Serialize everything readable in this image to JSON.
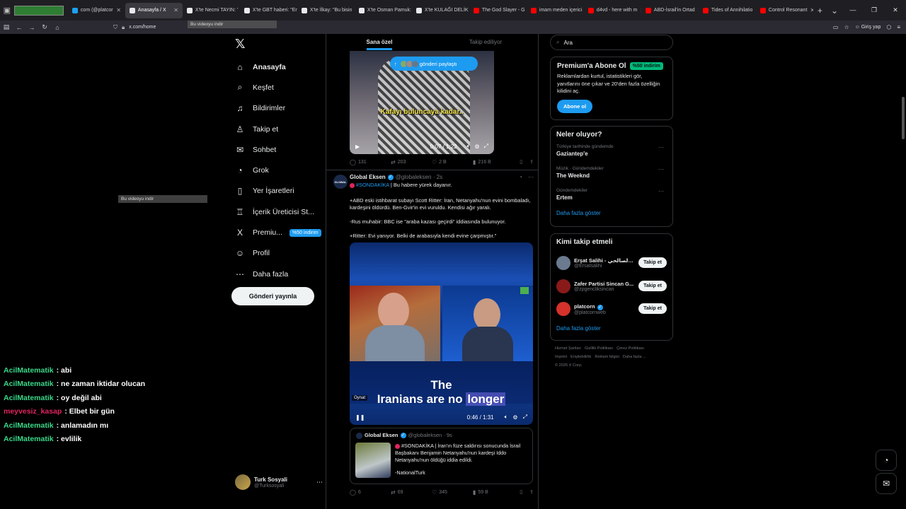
{
  "browser": {
    "tabs": [
      {
        "label": "com (@platcor",
        "color": "#1da1f2",
        "active": false
      },
      {
        "label": "Anasayfa / X",
        "color": "#e7e9ea",
        "active": true
      },
      {
        "label": "X'te Necmi TAYIN: '",
        "color": "#e7e9ea",
        "active": false
      },
      {
        "label": "X'te GBT haberi: \"En",
        "color": "#e7e9ea",
        "active": false
      },
      {
        "label": "X'te İlkay: \"Bu bisin",
        "color": "#e7e9ea",
        "active": false
      },
      {
        "label": "X'te Osman Pamuk:",
        "color": "#e7e9ea",
        "active": false
      },
      {
        "label": "X'te KULAĞI DELİK",
        "color": "#e7e9ea",
        "active": false
      },
      {
        "label": "The God Slayer - G",
        "color": "#ff0000",
        "active": false
      },
      {
        "label": "imam meden içerici",
        "color": "#ff0000",
        "active": false
      },
      {
        "label": "d4vd - here with m",
        "color": "#ff0000",
        "active": false
      },
      {
        "label": "ABD-İsrail'in Ortad",
        "color": "#ff0000",
        "active": false
      },
      {
        "label": "Tides of Annihilatio",
        "color": "#ff0000",
        "active": false
      },
      {
        "label": "Control Resonant",
        "color": "#ff0000",
        "active": false
      }
    ],
    "url": "x.com/home",
    "signin_label": "Giriş yap"
  },
  "sidebar": {
    "items": [
      {
        "label": "Anasayfa",
        "icon": "home-icon",
        "glyph": "⌂"
      },
      {
        "label": "Keşfet",
        "icon": "search-icon",
        "glyph": "⌕"
      },
      {
        "label": "Bildirimler",
        "icon": "bell-icon",
        "glyph": "♫"
      },
      {
        "label": "Takip et",
        "icon": "follow-icon",
        "glyph": "♙"
      },
      {
        "label": "Sohbet",
        "icon": "mail-icon",
        "glyph": "✉"
      },
      {
        "label": "Grok",
        "icon": "grok-icon",
        "glyph": "◔"
      },
      {
        "label": "Yer İşaretleri",
        "icon": "bookmark-icon",
        "glyph": "▯"
      },
      {
        "label": "İçerik Üreticisi St...",
        "icon": "creator-icon",
        "glyph": "♖"
      },
      {
        "label": "Premiu...",
        "icon": "x-premium-icon",
        "glyph": "X",
        "badge": "%50 indirim"
      },
      {
        "label": "Profil",
        "icon": "profile-icon",
        "glyph": "☺"
      },
      {
        "label": "Daha fazla",
        "icon": "more-icon",
        "glyph": "⋯"
      }
    ],
    "post_button": "Gönderi yayınla",
    "account": {
      "name": "Turk Sosyali",
      "handle": "@Turksosyali"
    }
  },
  "chat": [
    {
      "user": "AcilMatematik",
      "msg": "abi",
      "color": "#39d98a"
    },
    {
      "user": "AcilMatematik",
      "msg": "ne zaman iktidar olucan",
      "color": "#39d98a"
    },
    {
      "user": "AcilMatematik",
      "msg": "oy değil abi",
      "color": "#39d98a"
    },
    {
      "user": "meyvesiz_kasap",
      "msg": "Elbet bir gün",
      "color": "#e0245e"
    },
    {
      "user": "AcilMatematik",
      "msg": "anlamadın mı",
      "color": "#39d98a"
    },
    {
      "user": "AcilMatematik",
      "msg": "evlilik",
      "color": "#39d98a"
    }
  ],
  "feed": {
    "tabs": [
      "Sana özel",
      "Takip ediliyor"
    ],
    "share_pill": "gönderi paylaştı",
    "download_hint": "Bu videoyu indir",
    "video1": {
      "subtitle": "Kafayı buluncaya kadar..",
      "time": "0:07 / 1:22"
    },
    "post1_actions": {
      "replies": "131",
      "reposts": "203",
      "likes": "2 B",
      "views": "216 B"
    },
    "post2": {
      "name": "Global Eksen",
      "handle": "@globaleksen",
      "age": "2s",
      "avatar_text": "GLOBAL",
      "headline_tag": "#SONDAKİKA",
      "headline_rest": " | Bu habere yürek dayanır.",
      "para1": "+ABD eski istihbarat subayı Scott Ritter: İran, Netanyahu'nun evini bombaladı, kardeşini öldürdü.  Ben-Gvir'in evi vuruldu. Kendisi ağır yaralı.",
      "para2": "-Rus muhabir: BBC ise \"araba kazası geçirdi\" iddiasında bulunuyor.",
      "para3": "+Ritter: Evi yanıyor. Belki de arabasıyla kendi evine çarpmıştır.\"",
      "video_caption_line1": "The",
      "video_caption_line2a": "Iranians are no ",
      "video_caption_line2b": "longer",
      "video_overlay": "Oynat",
      "video_time": "0:46 / 1:31",
      "quote": {
        "name": "Global Eksen",
        "handle": "@globaleksen",
        "age": "9s",
        "tag": "#SONDAKİKA",
        "text": " | İran'ın füze saldırısı sonucunda İsrail Başbakanı Benjamin Netanyahu'nun kardeşi Iddo Netanyahu'nun öldüğü iddia edildi.",
        "source": "-NationalTurk"
      },
      "actions": {
        "replies": "6",
        "reposts": "69",
        "likes": "345",
        "views": "59 B"
      }
    }
  },
  "right": {
    "search_placeholder": "Ara",
    "premium": {
      "title": "Premium'a Abone Ol",
      "discount": "%50 indirim",
      "desc": "Reklamlardan kurtul, istatistikleri gör, yanıtlarını öne çıkar ve 20'den fazla özelliğin kilidini aç.",
      "button": "Abone ol"
    },
    "trends": {
      "title": "Neler oluyor?",
      "items": [
        {
          "context": "Türkiye tarihinde gündemde",
          "name": "Gaziantep'e"
        },
        {
          "context": "Müzik · Gündemdekiler",
          "name": "The Weeknd"
        },
        {
          "context": "Gündemdekiler",
          "name": "Ertem"
        }
      ],
      "show_more": "Daha fazla göster"
    },
    "follow": {
      "title": "Kimi takip etmeli",
      "users": [
        {
          "name": "Erşat Salihi - الصالحي ...",
          "handle": "@Ersatsalihi",
          "color": "#6b7a8f"
        },
        {
          "name": "Zafer Partisi Sincan G...",
          "handle": "@zpgencliksincan",
          "color": "#8a1a1a"
        },
        {
          "name": "platcorn",
          "handle": "@platcornweb",
          "color": "#d4322a",
          "verified": true
        }
      ],
      "button": "Takip et",
      "show_more": "Daha fazla göster"
    },
    "footer": [
      "Hizmet Şartları",
      "Gizlilik Politikası",
      "Çerez Politikası",
      "Imprint",
      "Erişilebilirlik",
      "Reklam bilgisi",
      "Daha fazla ...",
      "© 2026 X Corp."
    ]
  }
}
